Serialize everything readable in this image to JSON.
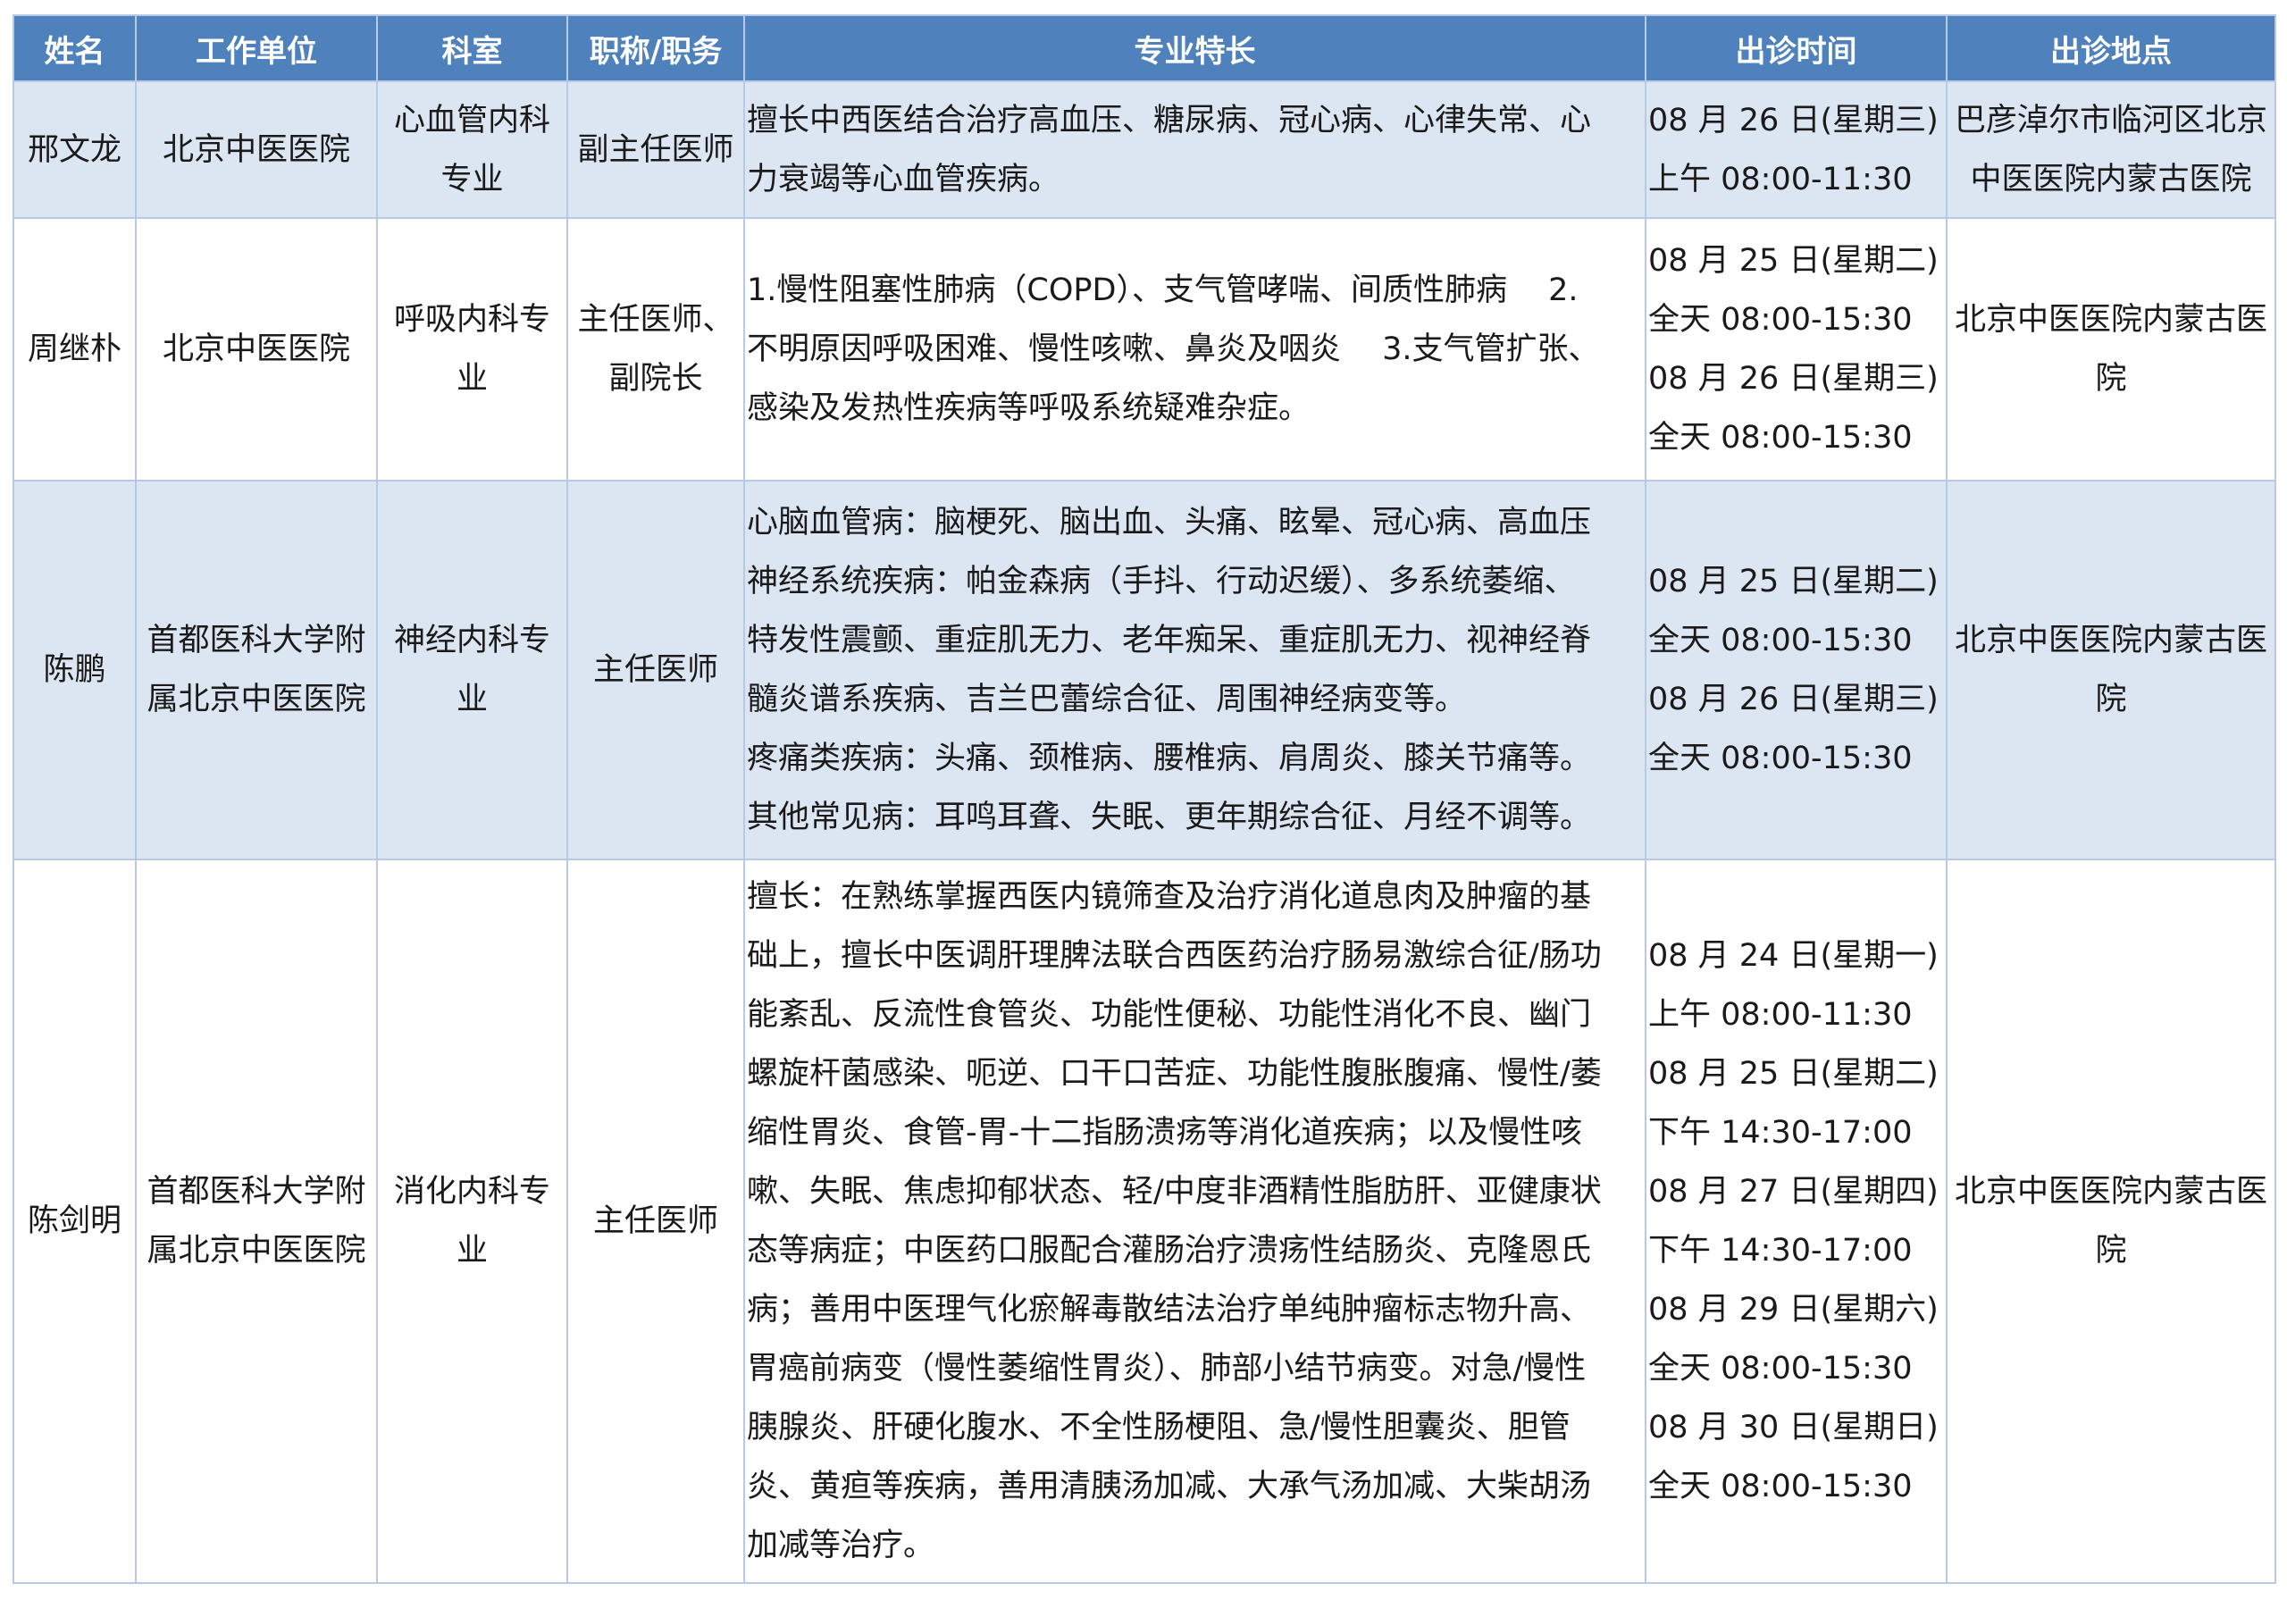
{
  "headers": [
    "姓名",
    "工作单位",
    "科室",
    "职称/职务",
    "专业特长",
    "出诊时间",
    "出诊地点"
  ],
  "rows": [
    {
      "name": "邢文龙",
      "unit_lines": [
        "北京中医医院"
      ],
      "dept_lines": [
        "心血管内科",
        "专业"
      ],
      "title_lines": [
        "副主任医师"
      ],
      "spec_lines": [
        "擅长中西医结合治疗高血压、糖尿病、冠心病、心律失常、心",
        "力衰竭等心血管疾病。"
      ],
      "time_lines": [
        "08 月 26 日(星期三)",
        "上午 08:00-11:30"
      ],
      "place_lines": [
        "巴彦淖尔市临河区北京",
        "中医医院内蒙古医院"
      ]
    },
    {
      "name": "周继朴",
      "unit_lines": [
        "北京中医医院"
      ],
      "dept_lines": [
        "呼吸内科专",
        "业"
      ],
      "title_lines": [
        "主任医师、",
        "副院长"
      ],
      "spec_lines": [
        "1.慢性阻塞性肺病（COPD）、支气管哮喘、间质性肺病　 2.",
        "不明原因呼吸困难、慢性咳嗽、鼻炎及咽炎　 3.支气管扩张、",
        "感染及发热性疾病等呼吸系统疑难杂症。"
      ],
      "time_lines": [
        "08 月 25 日(星期二)",
        "全天 08:00-15:30",
        "08 月 26 日(星期三)",
        "全天 08:00-15:30"
      ],
      "place_lines": [
        "北京中医医院内蒙古医",
        "院"
      ]
    },
    {
      "name": "陈鹏",
      "unit_lines": [
        "首都医科大学附",
        "属北京中医医院"
      ],
      "dept_lines": [
        "神经内科专",
        "业"
      ],
      "title_lines": [
        "主任医师"
      ],
      "spec_lines": [
        "心脑血管病：脑梗死、脑出血、头痛、眩晕、冠心病、高血压",
        "神经系统疾病：帕金森病（手抖、行动迟缓）、多系统萎缩、",
        "特发性震颤、重症肌无力、老年痴呆、重症肌无力、视神经脊",
        "髓炎谱系疾病、吉兰巴蕾综合征、周围神经病变等。",
        "疼痛类疾病：头痛、颈椎病、腰椎病、肩周炎、膝关节痛等。",
        "其他常见病：耳鸣耳聋、失眠、更年期综合征、月经不调等。"
      ],
      "time_lines": [
        "08 月 25 日(星期二)",
        "全天 08:00-15:30",
        "08 月 26 日(星期三)",
        "全天 08:00-15:30"
      ],
      "place_lines": [
        "北京中医医院内蒙古医",
        "院"
      ]
    },
    {
      "name": "陈剑明",
      "unit_lines": [
        "首都医科大学附",
        "属北京中医医院"
      ],
      "dept_lines": [
        "消化内科专",
        "业"
      ],
      "title_lines": [
        "主任医师"
      ],
      "spec_lines": [
        "擅长：在熟练掌握西医内镜筛查及治疗消化道息肉及肿瘤的基",
        "础上，擅长中医调肝理脾法联合西医药治疗肠易激综合征/肠功",
        "能紊乱、反流性食管炎、功能性便秘、功能性消化不良、幽门",
        "螺旋杆菌感染、呃逆、口干口苦症、功能性腹胀腹痛、慢性/萎",
        "缩性胃炎、食管-胃-十二指肠溃疡等消化道疾病；以及慢性咳",
        "嗽、失眠、焦虑抑郁状态、轻/中度非酒精性脂肪肝、亚健康状",
        "态等病症；中医药口服配合灌肠治疗溃疡性结肠炎、克隆恩氏",
        "病；善用中医理气化瘀解毒散结法治疗单纯肿瘤标志物升高、",
        "胃癌前病变（慢性萎缩性胃炎）、肺部小结节病变。对急/慢性",
        "胰腺炎、肝硬化腹水、不全性肠梗阻、急/慢性胆囊炎、胆管",
        "炎、黄疸等疾病，善用清胰汤加减、大承气汤加减、大柴胡汤",
        "加减等治疗。"
      ],
      "time_lines": [
        "08 月 24 日(星期一)",
        "上午 08:00-11:30",
        "08 月 25 日(星期二)",
        "下午 14:30-17:00",
        "08 月 27 日(星期四)",
        "下午 14:30-17:00",
        "08 月 29 日(星期六)",
        "全天 08:00-15:30",
        "08 月 30 日(星期日)",
        "全天 08:00-15:30"
      ],
      "place_lines": [
        "北京中医医院内蒙古医",
        "院"
      ]
    }
  ],
  "colors": {
    "header_bg": "#4f81bd",
    "header_text": "#ffffff",
    "alt_row_bg": "#dce6f2",
    "border": "#b7c9e4"
  }
}
